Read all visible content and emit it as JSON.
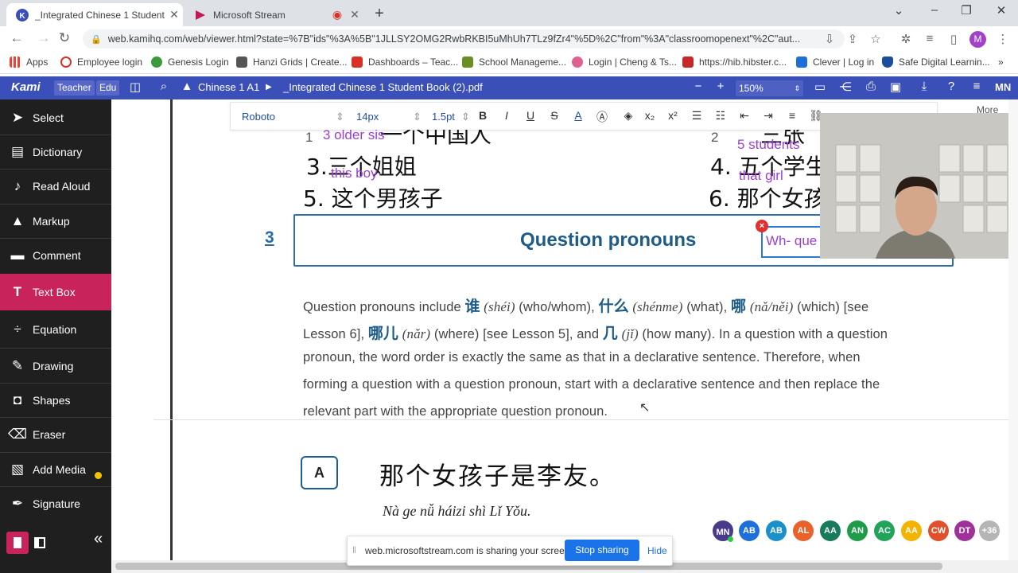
{
  "browser": {
    "tabs": [
      {
        "title": "_Integrated Chinese 1 Student Bo",
        "icon": "kami-icon"
      },
      {
        "title": "Microsoft Stream",
        "icon": "stream-icon"
      }
    ],
    "new_tab_label": "+",
    "url": "web.kamihq.com/web/viewer.html?state=%7B\"ids\"%3A%5B\"1JLLSY2OMG2RwbRKBI5uMhUh7TLz9fZr4\"%5D%2C\"from\"%3A\"classroomopenext\"%2C\"aut...",
    "profile_initial": "M",
    "bookmarks": [
      "Apps",
      "Employee login",
      "Genesis Login",
      "Hanzi Grids | Create...",
      "Dashboards – Teac...",
      "School Manageme...",
      "Login | Cheng & Ts...",
      "https://hib.hibster.c...",
      "Clever | Log in",
      "Safe Digital Learnin..."
    ],
    "bookmarks_more": "»"
  },
  "kami": {
    "logo": "Kami",
    "badges": [
      "Teacher",
      "Edu"
    ],
    "folder": "Chinese 1 A1",
    "filename": "_Integrated Chinese 1 Student Book (2).pdf",
    "zoom_minus": "−",
    "zoom_plus": "+",
    "zoom": "150%",
    "user_initials": "MN"
  },
  "sidebar": {
    "items": [
      {
        "label": "Select",
        "icon": "cursor-icon"
      },
      {
        "label": "Dictionary",
        "icon": "book-icon"
      },
      {
        "label": "Read Aloud",
        "icon": "speaker-icon"
      },
      {
        "label": "Markup",
        "icon": "highlighter-icon"
      },
      {
        "label": "Comment",
        "icon": "comment-icon"
      },
      {
        "label": "Text Box",
        "icon": "text-icon"
      },
      {
        "label": "Equation",
        "icon": "divide-icon"
      },
      {
        "label": "Drawing",
        "icon": "brush-icon"
      },
      {
        "label": "Shapes",
        "icon": "shapes-icon"
      },
      {
        "label": "Eraser",
        "icon": "eraser-icon"
      },
      {
        "label": "Add Media",
        "icon": "media-icon"
      },
      {
        "label": "Signature",
        "icon": "pen-icon"
      }
    ],
    "collapse": "«"
  },
  "palette": {
    "font_size": "14",
    "colors": [
      "#8b3ef0",
      "#000000",
      "#e00000"
    ]
  },
  "format_bar": {
    "font": "Roboto",
    "size": "14px",
    "spacing": "1.5pt",
    "more": "More"
  },
  "document": {
    "row1_left_num": "1",
    "row1_left_cn": "一个中国人",
    "row1_right_num": "2",
    "row1_right_cn": "三张",
    "item3": "3.三个姐姐",
    "item4": "4. 五个学生",
    "item5": "5. 这个男孩子",
    "item6": "6. 那个女孩",
    "annot_older_sis": "3 older sis",
    "annot_this_boy": "this boy",
    "annot_5_students": "5 students",
    "annot_that_girl": "that girl",
    "section_num": "3",
    "section_title": "Question pronouns",
    "textbox_content": "Wh- que",
    "textbox_close": "×",
    "para": {
      "l1_a": "Question pronouns include ",
      "shei_cn": "谁",
      "shei_py": "(shéi)",
      "l1_b": " (who/whom), ",
      "shenme_cn": "什么",
      "shenme_py": "(shénme)",
      "l1_c": " (what), ",
      "na_cn": "哪",
      "na_py": "(nǎ/něi)",
      "l1_d": " (which) [see",
      "l2_a": "Lesson 6], ",
      "nar_cn": "哪儿",
      "nar_py": "(nǎr)",
      "l2_b": " (where) [see Lesson 5], and ",
      "ji_cn": "几",
      "ji_py": "(jǐ)",
      "l2_c": " (how many). In a question with a question",
      "l3": "pronoun, the word order is exactly the same as that in a declarative sentence. Therefore, when",
      "l4": "forming a question with a question pronoun, start with a declarative sentence and then replace the",
      "l5": "relevant part with the appropriate question pronoun."
    },
    "example_label": "A",
    "example_cn": "那个女孩子是李友。",
    "example_pinyin": "Nà ge nǚ háizi shì Lǐ Yǒu."
  },
  "collaborators": [
    {
      "initials": "MN",
      "color": "#4a3a8a"
    },
    {
      "initials": "AB",
      "color": "#1e6fd9"
    },
    {
      "initials": "AB",
      "color": "#1a8fc9"
    },
    {
      "initials": "AL",
      "color": "#e8622a"
    },
    {
      "initials": "AA",
      "color": "#177a5a"
    },
    {
      "initials": "AN",
      "color": "#1e9c4a"
    },
    {
      "initials": "AC",
      "color": "#22a35a"
    },
    {
      "initials": "AA",
      "color": "#f2b400"
    },
    {
      "initials": "CW",
      "color": "#e0502a"
    },
    {
      "initials": "DT",
      "color": "#a0309a"
    },
    {
      "initials": "+36",
      "color": "#b5b5b5"
    }
  ],
  "share_banner": {
    "message": "web.microsoftstream.com is sharing your screen.",
    "stop": "Stop sharing",
    "hide": "Hide"
  }
}
